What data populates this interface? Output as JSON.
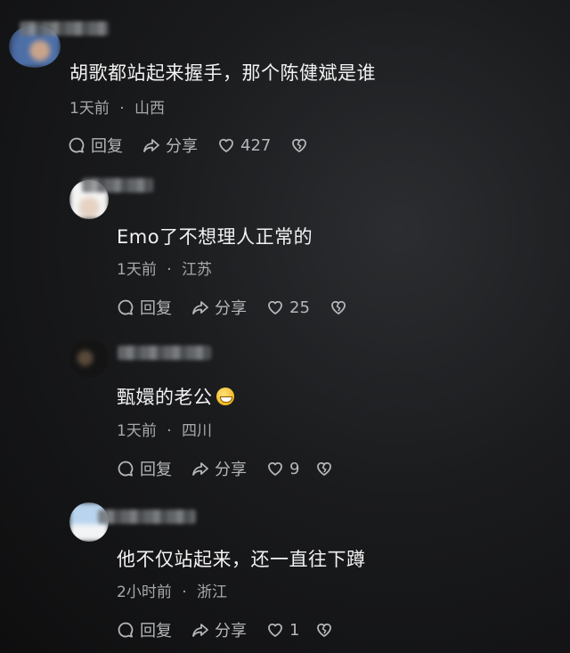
{
  "comments": [
    {
      "text": "胡歌都站起来握手，那个陈健斌是谁",
      "time": "1天前",
      "location": "山西",
      "reply_label": "回复",
      "share_label": "分享",
      "likes": "427"
    },
    {
      "text": "Emo了不想理人正常的",
      "time": "1天前",
      "location": "江苏",
      "reply_label": "回复",
      "share_label": "分享",
      "likes": "25"
    },
    {
      "text": "甄嬛的老公",
      "emoji": "grinning-emoji",
      "time": "1天前",
      "location": "四川",
      "reply_label": "回复",
      "share_label": "分享",
      "likes": "9"
    },
    {
      "text": "他不仅站起来，还一直往下蹲",
      "time": "2小时前",
      "location": "浙江",
      "reply_label": "回复",
      "share_label": "分享",
      "likes": "1"
    }
  ],
  "separator": "·",
  "icons": {
    "reply": "reply-bubble-icon",
    "share": "share-arrow-icon",
    "like": "heart-icon",
    "dislike": "broken-heart-icon"
  },
  "colors": {
    "background": "#1a1b1d",
    "text": "#f2f2f2",
    "meta": "#a7a9ac"
  }
}
